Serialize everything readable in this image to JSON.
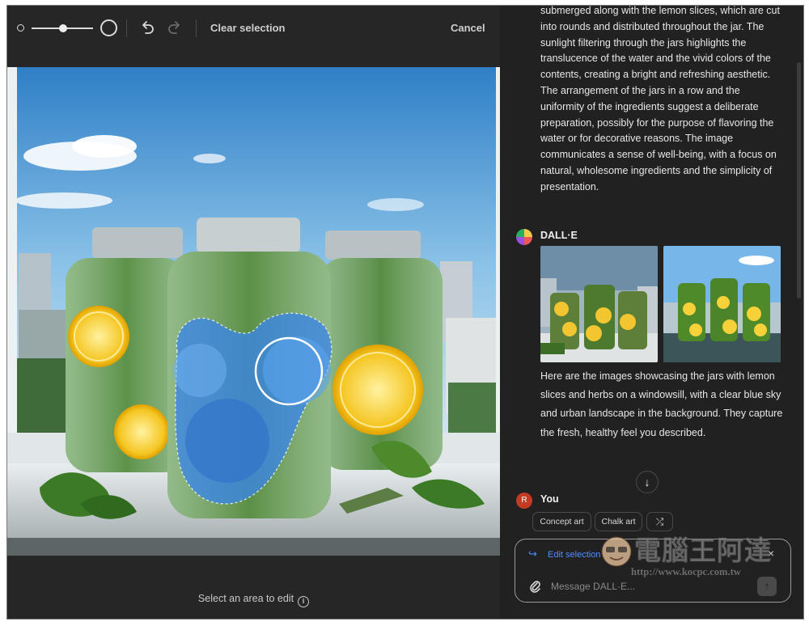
{
  "toolbar": {
    "clear_selection_label": "Clear selection",
    "cancel_label": "Cancel"
  },
  "editor": {
    "hint_label": "Select an area to edit",
    "hint_icon": "i"
  },
  "chat": {
    "description_text": "submerged along with the lemon slices, which are cut into rounds and distributed throughout the jar. The sunlight filtering through the jars highlights the translucence of the water and the vivid colors of the contents, creating a bright and refreshing aesthetic. The arrangement of the jars in a row and the uniformity of the ingredients suggest a deliberate preparation, possibly for the purpose of flavoring the water or for decorative reasons. The image communicates a sense of well-being, with a focus on natural, wholesome ingredients and the simplicity of presentation.",
    "assistant_name": "DALL·E",
    "assistant_reply": "Here are the images showcasing the jars with lemon slices and herbs on a windowsill, with a clear blue sky and urban landscape in the background. They capture the fresh, healthy feel you described.",
    "user_name": "You",
    "user_initial": "R",
    "scroll_down_glyph": "↓",
    "suggestions": [
      "Concept art",
      "Chalk art",
      "⤮"
    ]
  },
  "composer": {
    "edit_selection_label": "Edit selection",
    "edit_selection_icon": "↪",
    "close_glyph": "×",
    "placeholder": "Message DALL·E...",
    "send_glyph": "↑"
  },
  "watermark": {
    "title": "電腦王阿達",
    "url": "http://www.kocpc.com.tw"
  },
  "colors": {
    "accent_blue": "#4e8dff",
    "panel_bg": "#212121",
    "editor_bg": "#262626",
    "selection_mask": "#3a86e8"
  },
  "icons": [
    "brush-size-small-icon",
    "brush-size-large-icon",
    "undo-icon",
    "redo-icon",
    "info-icon",
    "arrow-down-icon",
    "shuffle-icon",
    "edit-selection-arrow-icon",
    "close-icon",
    "paperclip-icon",
    "send-arrow-icon"
  ]
}
